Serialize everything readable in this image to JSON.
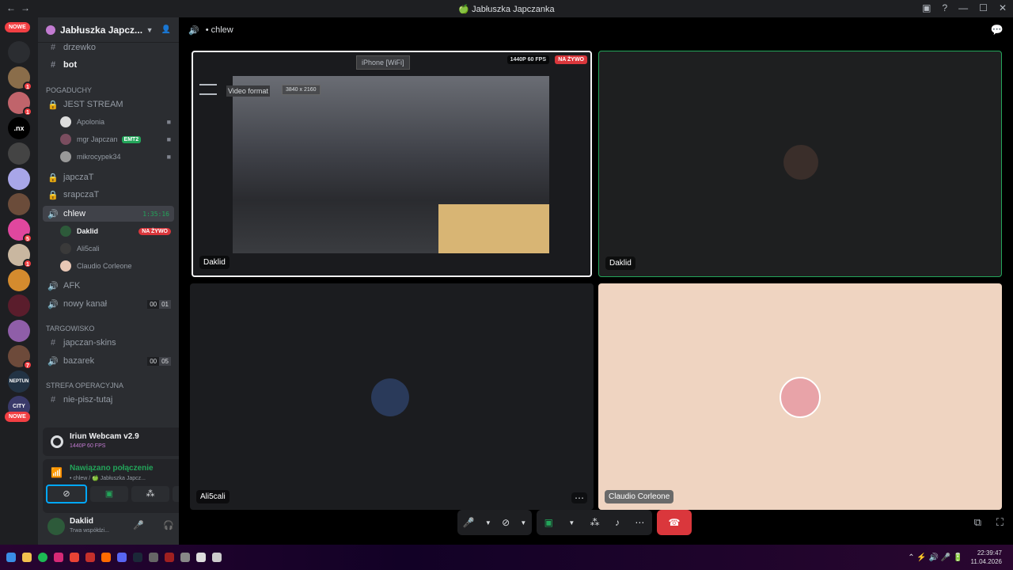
{
  "titlebar": {
    "title": "🍏 Jabłuszka Japczanka"
  },
  "servers": {
    "new_badge_top": "NOWE",
    "new_badge_bottom": "NOWE",
    "labels": [
      ".nx",
      "NEPTUN",
      "CITY"
    ],
    "badges": [
      "1",
      "1",
      "5",
      "1",
      "7"
    ]
  },
  "sidebar": {
    "guild_name": "Jabłuszka Japcz...",
    "channels_top": [
      {
        "name": "drzewko"
      },
      {
        "name": "bot"
      }
    ],
    "category1": "POGADUCHY",
    "stream_channel": "JEST STREAM",
    "stream_users": [
      {
        "name": "Apolonia"
      },
      {
        "name": "mgr Japczan",
        "tag": "EMT2"
      },
      {
        "name": "mikrocypek34"
      }
    ],
    "locked": [
      {
        "name": "japczaT"
      },
      {
        "name": "srapczaT"
      }
    ],
    "active_channel": {
      "name": "chlew",
      "time": "1:35:16"
    },
    "voice_users": [
      {
        "name": "Daklid",
        "live": "NA ŻYWO"
      },
      {
        "name": "Ali5cali"
      },
      {
        "name": "Claudio Corleone"
      }
    ],
    "afk": "AFK",
    "new_channel": {
      "name": "nowy kanał",
      "c1": "00",
      "c2": "01"
    },
    "category2": "TARGOWISKO",
    "skins": "japczan-skins",
    "bazarek": {
      "name": "bazarek",
      "c1": "00",
      "c2": "05"
    },
    "category3": "STREFA OPERACYJNA",
    "nie_pisz": "nie-pisz-tutaj"
  },
  "stream_panel": {
    "title": "Iriun Webcam v2.9",
    "quality": "1440P 60 FPS"
  },
  "voice_panel": {
    "status": "Nawiązano połączenie",
    "location": "• chlew / 🍏 Jabłuszka Japcz..."
  },
  "user_panel": {
    "name": "Daklid",
    "status": "Trwa współdzi..."
  },
  "main": {
    "channel": "• chlew",
    "tiles": [
      {
        "name": "Daklid",
        "device": "iPhone [WiFi]",
        "quality": "1440P 60 FPS",
        "live": "NA ŻYWO",
        "format_label": "Video format",
        "format_value": "3840 x 2160"
      },
      {
        "name": "Daklid"
      },
      {
        "name": "Ali5cali"
      },
      {
        "name": "Claudio Corleone"
      }
    ]
  },
  "taskbar": {
    "time": "22:39:47",
    "date": "11.04.2026"
  },
  "colors": {
    "accent": "#5865f2",
    "live": "#da373c",
    "green": "#23a55a"
  }
}
